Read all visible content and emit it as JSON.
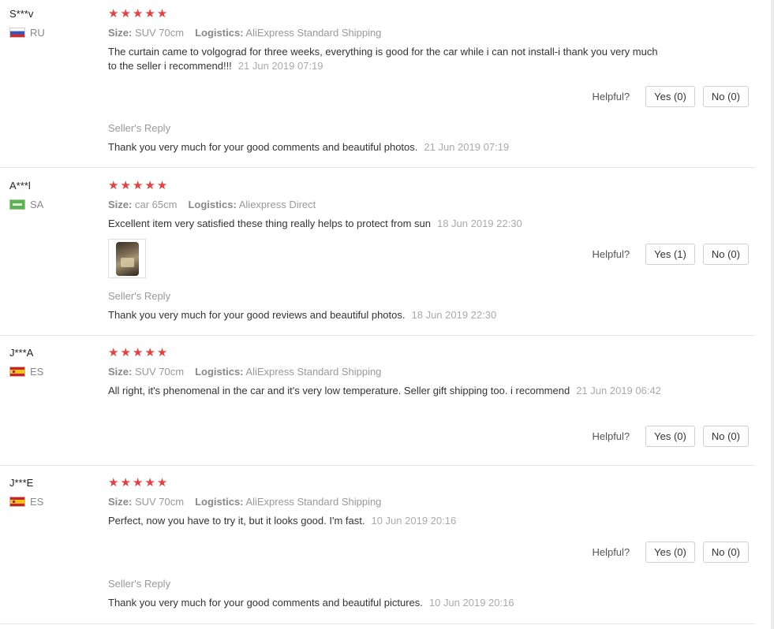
{
  "helpful_label": "Helpful?",
  "seller_reply_title": "Seller's Reply",
  "labels": {
    "size": "Size:",
    "logistics": "Logistics:"
  },
  "star_color": "#e93f3f",
  "stars_glyphs": "★★★★★",
  "reviews": [
    {
      "user": "S***v",
      "country": "RU",
      "rating": 5,
      "size": "SUV 70cm",
      "logistics": "AliExpress Standard Shipping",
      "text": "The curtain came to volgograd for three weeks, everything is good for the car while i can not install-i thank you very much to the seller i recommend!!!",
      "date": "21 Jun 2019 07:19",
      "yes": "Yes (0)",
      "no": "No (0)",
      "reply_text": "Thank you very much for your good comments and beautiful photos.",
      "reply_date": "21 Jun 2019 07:19"
    },
    {
      "user": "A***l",
      "country": "SA",
      "rating": 5,
      "size": "car 65cm",
      "logistics": "Aliexpress Direct",
      "text": "Excellent item very satisfied these thing really helps to protect from sun",
      "date": "18 Jun 2019 22:30",
      "yes": "Yes (1)",
      "no": "No (0)",
      "reply_text": "Thank you very much for your good reviews and beautiful photos.",
      "reply_date": "18 Jun 2019 22:30"
    },
    {
      "user": "J***A",
      "country": "ES",
      "rating": 5,
      "size": "SUV 70cm",
      "logistics": "AliExpress Standard Shipping",
      "text": "All right, it's phenomenal in the car and it's very low temperature. Seller gift shipping too. i recommend",
      "date": "21 Jun 2019 06:42",
      "yes": "Yes (0)",
      "no": "No (0)"
    },
    {
      "user": "J***E",
      "country": "ES",
      "rating": 5,
      "size": "SUV 70cm",
      "logistics": "AliExpress Standard Shipping",
      "text": "Perfect, now you have to try it, but it looks good. I'm fast.",
      "date": "10 Jun 2019 20:16",
      "yes": "Yes (0)",
      "no": "No (0)",
      "reply_text": "Thank you very much for your good comments and beautiful pictures.",
      "reply_date": "10 Jun 2019 20:16"
    }
  ]
}
